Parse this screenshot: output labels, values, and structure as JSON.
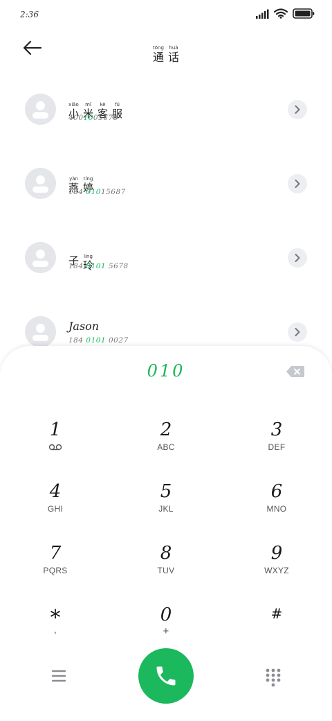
{
  "status_bar": {
    "time": "2:36"
  },
  "header": {
    "title_pinyin": [
      "tōng",
      "huà"
    ],
    "title_chars": [
      "通",
      "话"
    ]
  },
  "contacts": [
    {
      "name_pinyin": [
        "xiǎo",
        "mǐ",
        "kè",
        "fú"
      ],
      "name_chars": [
        "小",
        "米",
        "客",
        "服"
      ],
      "number_parts": [
        "400",
        "10",
        "05678"
      ],
      "highlight_index": 1
    },
    {
      "name_pinyin": [
        "yàn",
        "tíng"
      ],
      "name_chars": [
        "燕",
        "婷"
      ],
      "number_parts": [
        "184 ",
        "010",
        "15687"
      ],
      "highlight_index": 1
    },
    {
      "name_pinyin": [
        "",
        "líng"
      ],
      "name_chars": [
        "子",
        "玲"
      ],
      "number_parts": [
        "184 ",
        "0101",
        " 5678"
      ],
      "highlight_index": 1
    },
    {
      "name_text": "Jason",
      "number_parts": [
        "184 ",
        "0101",
        " 0027"
      ],
      "highlight_index": 1
    }
  ],
  "dialpad": {
    "input_value": "010",
    "keys": [
      {
        "digit": "1",
        "letters": ""
      },
      {
        "digit": "2",
        "letters": "ABC"
      },
      {
        "digit": "3",
        "letters": "DEF"
      },
      {
        "digit": "4",
        "letters": "GHI"
      },
      {
        "digit": "5",
        "letters": "JKL"
      },
      {
        "digit": "6",
        "letters": "MNO"
      },
      {
        "digit": "7",
        "letters": "PQRS"
      },
      {
        "digit": "8",
        "letters": "TUV"
      },
      {
        "digit": "9",
        "letters": "WXYZ"
      },
      {
        "digit": "*",
        "letters": ","
      },
      {
        "digit": "0",
        "letters": "+"
      },
      {
        "digit": "#",
        "letters": ""
      }
    ]
  },
  "colors": {
    "accent_green": "#1bb85d",
    "highlight_green": "#15b760"
  },
  "icons": [
    "signal-icon",
    "wifi-icon",
    "battery-icon",
    "back-arrow-icon",
    "chevron-right-icon",
    "voicemail-icon",
    "backspace-icon",
    "menu-icon",
    "phone-icon",
    "keypad-icon"
  ]
}
